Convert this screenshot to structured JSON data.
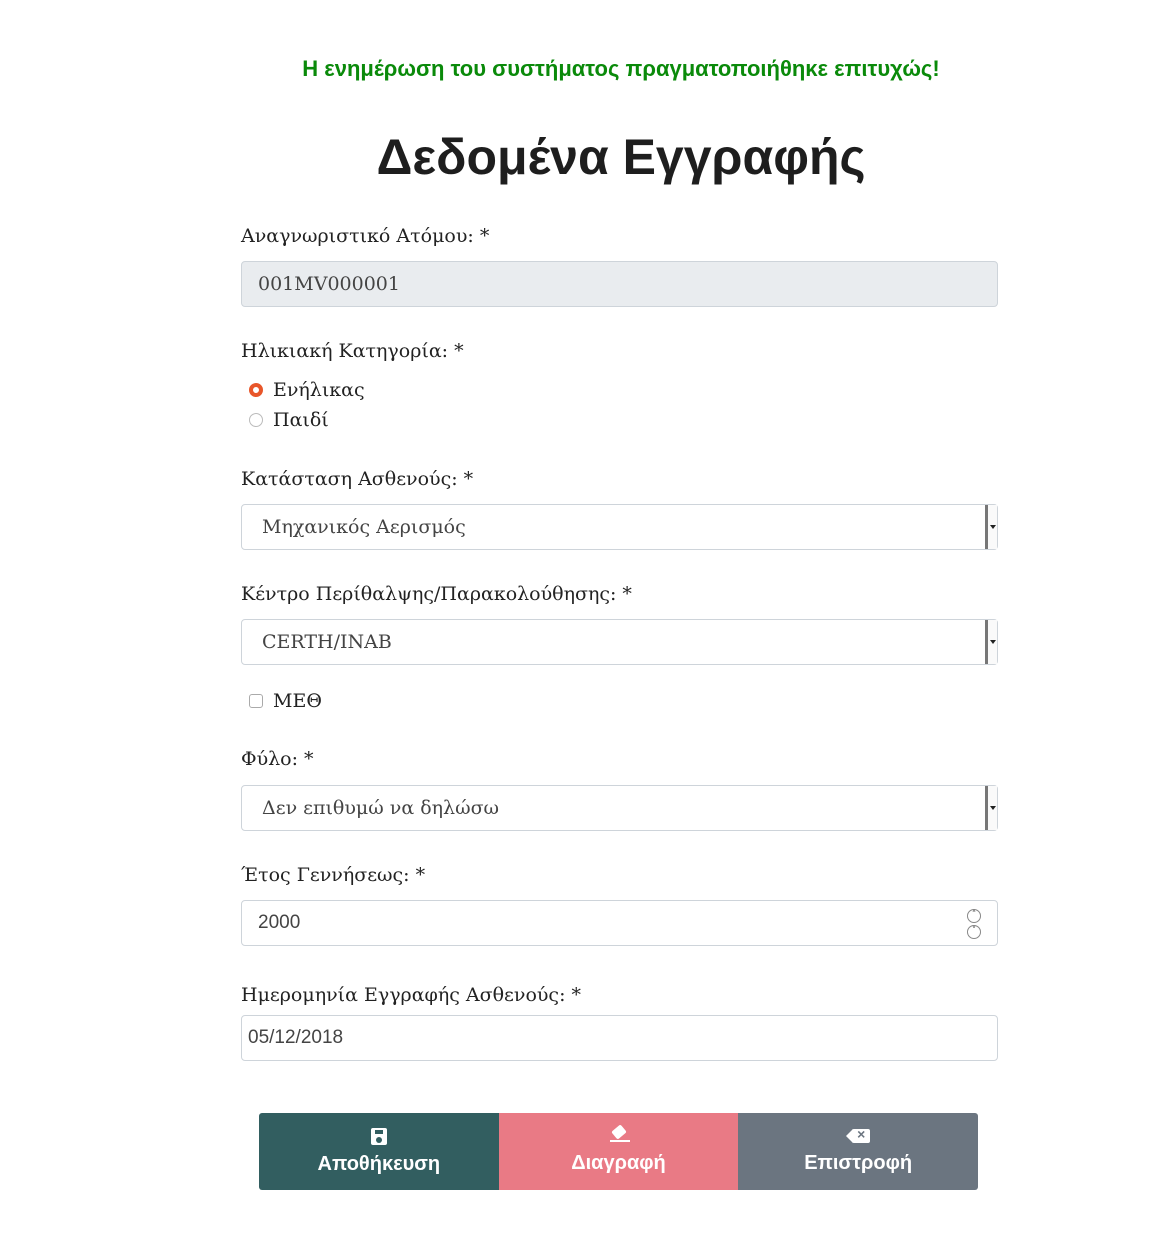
{
  "message": "Η ενημέρωση του συστήματος πραγματοποιήθηκε επιτυχώς!",
  "title": "Δεδομένα Εγγραφής",
  "person_id": {
    "label": "Αναγνωριστικό Ατόμου: *",
    "value": "001MV000001"
  },
  "age_category": {
    "label": "Ηλικιακή Κατηγορία: *",
    "options": [
      {
        "label": "Ενήλικας",
        "checked": true
      },
      {
        "label": "Παιδί",
        "checked": false
      }
    ]
  },
  "patient_status": {
    "label": "Κατάσταση Ασθενούς: *",
    "value": "Μηχανικός Αερισμός"
  },
  "care_center": {
    "label": "Κέντρο Περίθαλψης/Παρακολούθησης: *",
    "value": "CERTH/INAB"
  },
  "icu": {
    "label": "ΜΕΘ",
    "checked": false
  },
  "gender": {
    "label": "Φύλο: *",
    "value": "Δεν επιθυμώ να δηλώσω"
  },
  "birth_year": {
    "label": "Έτος Γεννήσεως: *",
    "value": "2000"
  },
  "registration_date": {
    "label": "Ημερομηνία Εγγραφής Ασθενούς: *",
    "value": "05/12/2018"
  },
  "buttons": {
    "save": "Αποθήκευση",
    "delete": "Διαγραφή",
    "back": "Επιστροφή"
  },
  "colors": {
    "success": "#0a8a0a",
    "save": "#325e60",
    "delete": "#e97a85",
    "back": "#6b7580",
    "radio": "#e8562a"
  }
}
